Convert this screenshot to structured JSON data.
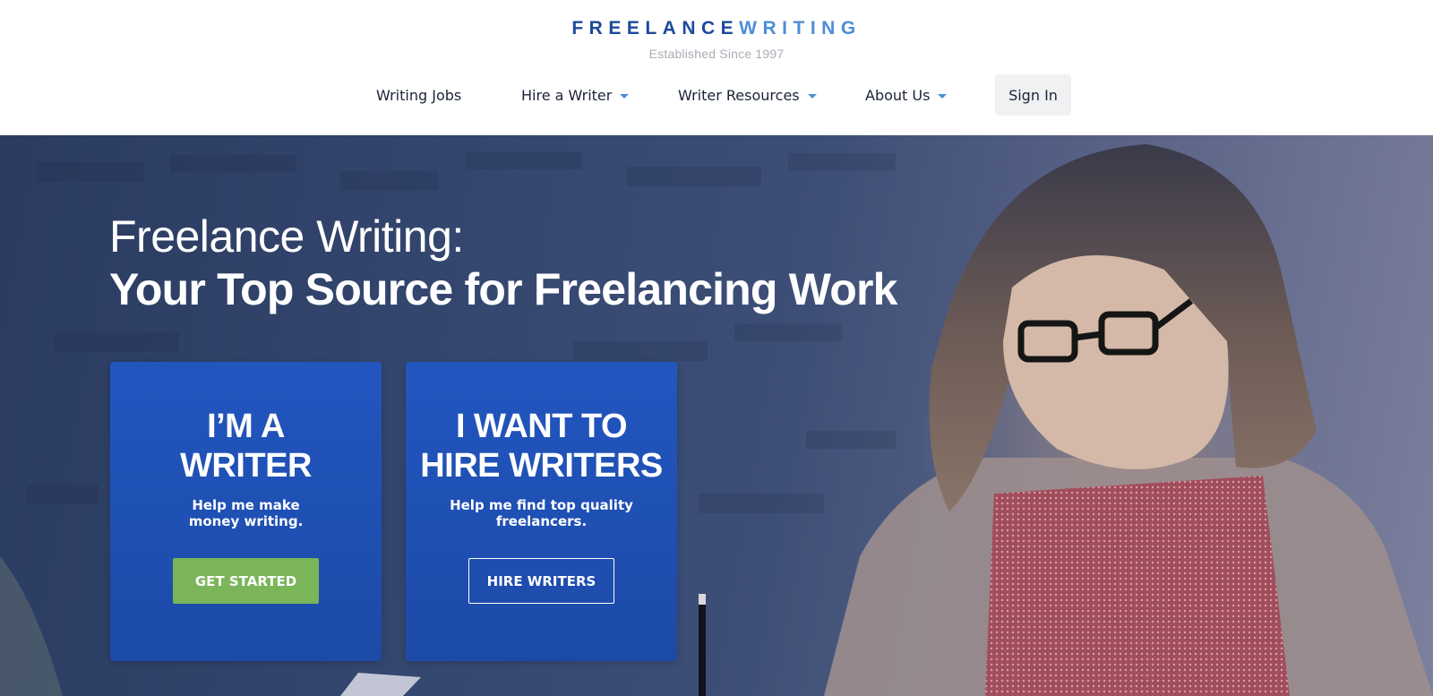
{
  "header": {
    "logo_part1": "FREELANCE",
    "logo_part2": "WRITING",
    "tagline": "Established Since 1997",
    "nav": [
      {
        "label": "Writing Jobs",
        "has_dropdown": false
      },
      {
        "label": "Hire a Writer",
        "has_dropdown": true
      },
      {
        "label": "Writer Resources",
        "has_dropdown": true
      },
      {
        "label": "About Us",
        "has_dropdown": true
      }
    ],
    "signin_label": "Sign In"
  },
  "hero": {
    "headline_line1": "Freelance Writing:",
    "headline_line2": "Your Top Source for Freelancing Work",
    "cards": [
      {
        "title_line1": "I’M A",
        "title_line2": "WRITER",
        "subtitle_line1": "Help me make",
        "subtitle_line2": "money writing.",
        "button_label": "GET STARTED"
      },
      {
        "title_line1": "I WANT TO",
        "title_line2": "HIRE WRITERS",
        "subtitle_line1": "Help me find top quality",
        "subtitle_line2": "freelancers.",
        "button_label": "HIRE WRITERS"
      }
    ]
  },
  "colors": {
    "brand_dark": "#1b4a9c",
    "brand_light": "#4d8ed6",
    "card_blue": "#2256bf",
    "cta_green": "#7ab55a",
    "text_dark": "#1b2437"
  },
  "icons": {
    "nav_dropdown": "chevron-down-icon"
  }
}
